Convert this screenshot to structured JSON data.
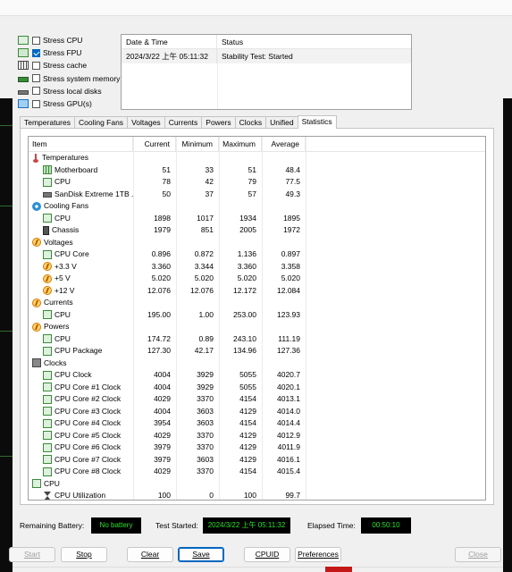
{
  "stress_options": [
    {
      "label": "Stress CPU",
      "checked": false,
      "icon": "cpu-chip-icon"
    },
    {
      "label": "Stress FPU",
      "checked": true,
      "icon": "fpu-icon"
    },
    {
      "label": "Stress cache",
      "checked": false,
      "icon": "cache-icon"
    },
    {
      "label": "Stress system memory",
      "checked": false,
      "icon": "memory-icon"
    },
    {
      "label": "Stress local disks",
      "checked": false,
      "icon": "disk-icon"
    },
    {
      "label": "Stress GPU(s)",
      "checked": false,
      "icon": "monitor-icon"
    }
  ],
  "log": {
    "headers": [
      "Date & Time",
      "Status"
    ],
    "rows": [
      {
        "time": "2024/3/22 上午 05:11:32",
        "status": "Stability Test: Started"
      }
    ]
  },
  "tabs": [
    "Temperatures",
    "Cooling Fans",
    "Voltages",
    "Currents",
    "Powers",
    "Clocks",
    "Unified",
    "Statistics"
  ],
  "active_tab": "Statistics",
  "table": {
    "headers": [
      "Item",
      "Current",
      "Minimum",
      "Maximum",
      "Average"
    ],
    "rows": [
      {
        "type": "group",
        "icon": "therm",
        "item": "Temperatures"
      },
      {
        "type": "child",
        "icon": "mb",
        "item": "Motherboard",
        "cur": "51",
        "min": "33",
        "max": "51",
        "avg": "48.4"
      },
      {
        "type": "child",
        "icon": "cpusq",
        "item": "CPU",
        "cur": "78",
        "min": "42",
        "max": "79",
        "avg": "77.5"
      },
      {
        "type": "child",
        "icon": "disk",
        "item": "SanDisk Extreme 1TB ...",
        "cur": "50",
        "min": "37",
        "max": "57",
        "avg": "49.3"
      },
      {
        "type": "group",
        "icon": "fan",
        "item": "Cooling Fans"
      },
      {
        "type": "child",
        "icon": "cpusq",
        "item": "CPU",
        "cur": "1898",
        "min": "1017",
        "max": "1934",
        "avg": "1895"
      },
      {
        "type": "child",
        "icon": "case",
        "item": "Chassis",
        "cur": "1979",
        "min": "851",
        "max": "2005",
        "avg": "1972"
      },
      {
        "type": "group",
        "icon": "bolt",
        "item": "Voltages"
      },
      {
        "type": "child",
        "icon": "cpusq",
        "item": "CPU Core",
        "cur": "0.896",
        "min": "0.872",
        "max": "1.136",
        "avg": "0.897"
      },
      {
        "type": "child",
        "icon": "bolt",
        "item": "+3.3 V",
        "cur": "3.360",
        "min": "3.344",
        "max": "3.360",
        "avg": "3.358"
      },
      {
        "type": "child",
        "icon": "bolt",
        "item": "+5 V",
        "cur": "5.020",
        "min": "5.020",
        "max": "5.020",
        "avg": "5.020"
      },
      {
        "type": "child",
        "icon": "bolt",
        "item": "+12 V",
        "cur": "12.076",
        "min": "12.076",
        "max": "12.172",
        "avg": "12.084"
      },
      {
        "type": "group",
        "icon": "bolt",
        "item": "Currents"
      },
      {
        "type": "child",
        "icon": "cpusq",
        "item": "CPU",
        "cur": "195.00",
        "min": "1.00",
        "max": "253.00",
        "avg": "123.93"
      },
      {
        "type": "group",
        "icon": "bolt",
        "item": "Powers"
      },
      {
        "type": "child",
        "icon": "cpusq",
        "item": "CPU",
        "cur": "174.72",
        "min": "0.89",
        "max": "243.10",
        "avg": "111.19"
      },
      {
        "type": "child",
        "icon": "cpusq",
        "item": "CPU Package",
        "cur": "127.30",
        "min": "42.17",
        "max": "134.96",
        "avg": "127.36"
      },
      {
        "type": "group",
        "icon": "clk",
        "item": "Clocks"
      },
      {
        "type": "child",
        "icon": "cpusq",
        "item": "CPU Clock",
        "cur": "4004",
        "min": "3929",
        "max": "5055",
        "avg": "4020.7"
      },
      {
        "type": "child",
        "icon": "cpusq",
        "item": "CPU Core #1 Clock",
        "cur": "4004",
        "min": "3929",
        "max": "5055",
        "avg": "4020.1"
      },
      {
        "type": "child",
        "icon": "cpusq",
        "item": "CPU Core #2 Clock",
        "cur": "4029",
        "min": "3370",
        "max": "4154",
        "avg": "4013.1"
      },
      {
        "type": "child",
        "icon": "cpusq",
        "item": "CPU Core #3 Clock",
        "cur": "4004",
        "min": "3603",
        "max": "4129",
        "avg": "4014.0"
      },
      {
        "type": "child",
        "icon": "cpusq",
        "item": "CPU Core #4 Clock",
        "cur": "3954",
        "min": "3603",
        "max": "4154",
        "avg": "4014.4"
      },
      {
        "type": "child",
        "icon": "cpusq",
        "item": "CPU Core #5 Clock",
        "cur": "4029",
        "min": "3370",
        "max": "4129",
        "avg": "4012.9"
      },
      {
        "type": "child",
        "icon": "cpusq",
        "item": "CPU Core #6 Clock",
        "cur": "3979",
        "min": "3370",
        "max": "4129",
        "avg": "4011.9"
      },
      {
        "type": "child",
        "icon": "cpusq",
        "item": "CPU Core #7 Clock",
        "cur": "3979",
        "min": "3603",
        "max": "4129",
        "avg": "4016.1"
      },
      {
        "type": "child",
        "icon": "cpusq",
        "item": "CPU Core #8 Clock",
        "cur": "4029",
        "min": "3370",
        "max": "4154",
        "avg": "4015.4"
      },
      {
        "type": "group",
        "icon": "cpusq",
        "item": "CPU"
      },
      {
        "type": "child",
        "icon": "hglass",
        "item": "CPU Utilization",
        "cur": "100",
        "min": "0",
        "max": "100",
        "avg": "99.7"
      }
    ]
  },
  "status": {
    "battery_label": "Remaining Battery:",
    "battery_value": "No battery",
    "started_label": "Test Started:",
    "started_value": "2024/3/22 上午 05:11:32",
    "elapsed_label": "Elapsed Time:",
    "elapsed_value": "00:50:10"
  },
  "buttons": {
    "start": "Start",
    "stop": "Stop",
    "clear": "Clear",
    "save": "Save",
    "cpuid": "CPUID",
    "preferences": "Preferences",
    "close": "Close"
  },
  "colors": {
    "accent": "#0067c0",
    "status_text": "#2fe02f",
    "status_bg": "#000000"
  }
}
